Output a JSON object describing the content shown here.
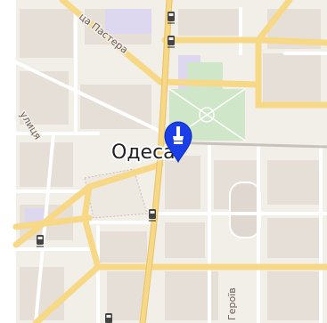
{
  "map": {
    "city_label": "Одеса",
    "streets": {
      "pasteur": "ца Пастера",
      "vertical_left": "улиця",
      "bottom": "Героїв"
    },
    "marker": {
      "icon": "map-pin-marker-icon",
      "color": "#1a3ee8"
    },
    "transit_icons": [
      "tram-stop-icon",
      "tram-stop-icon",
      "tram-stop-icon",
      "tram-stop-icon",
      "tram-stop-icon"
    ],
    "colors": {
      "land": "#f2efe9",
      "block": "#e4ddd6",
      "road_major": "#f7d886",
      "road_minor": "#ffffff",
      "park": "#cfe7c8",
      "campus": "#ddd7ef"
    }
  }
}
